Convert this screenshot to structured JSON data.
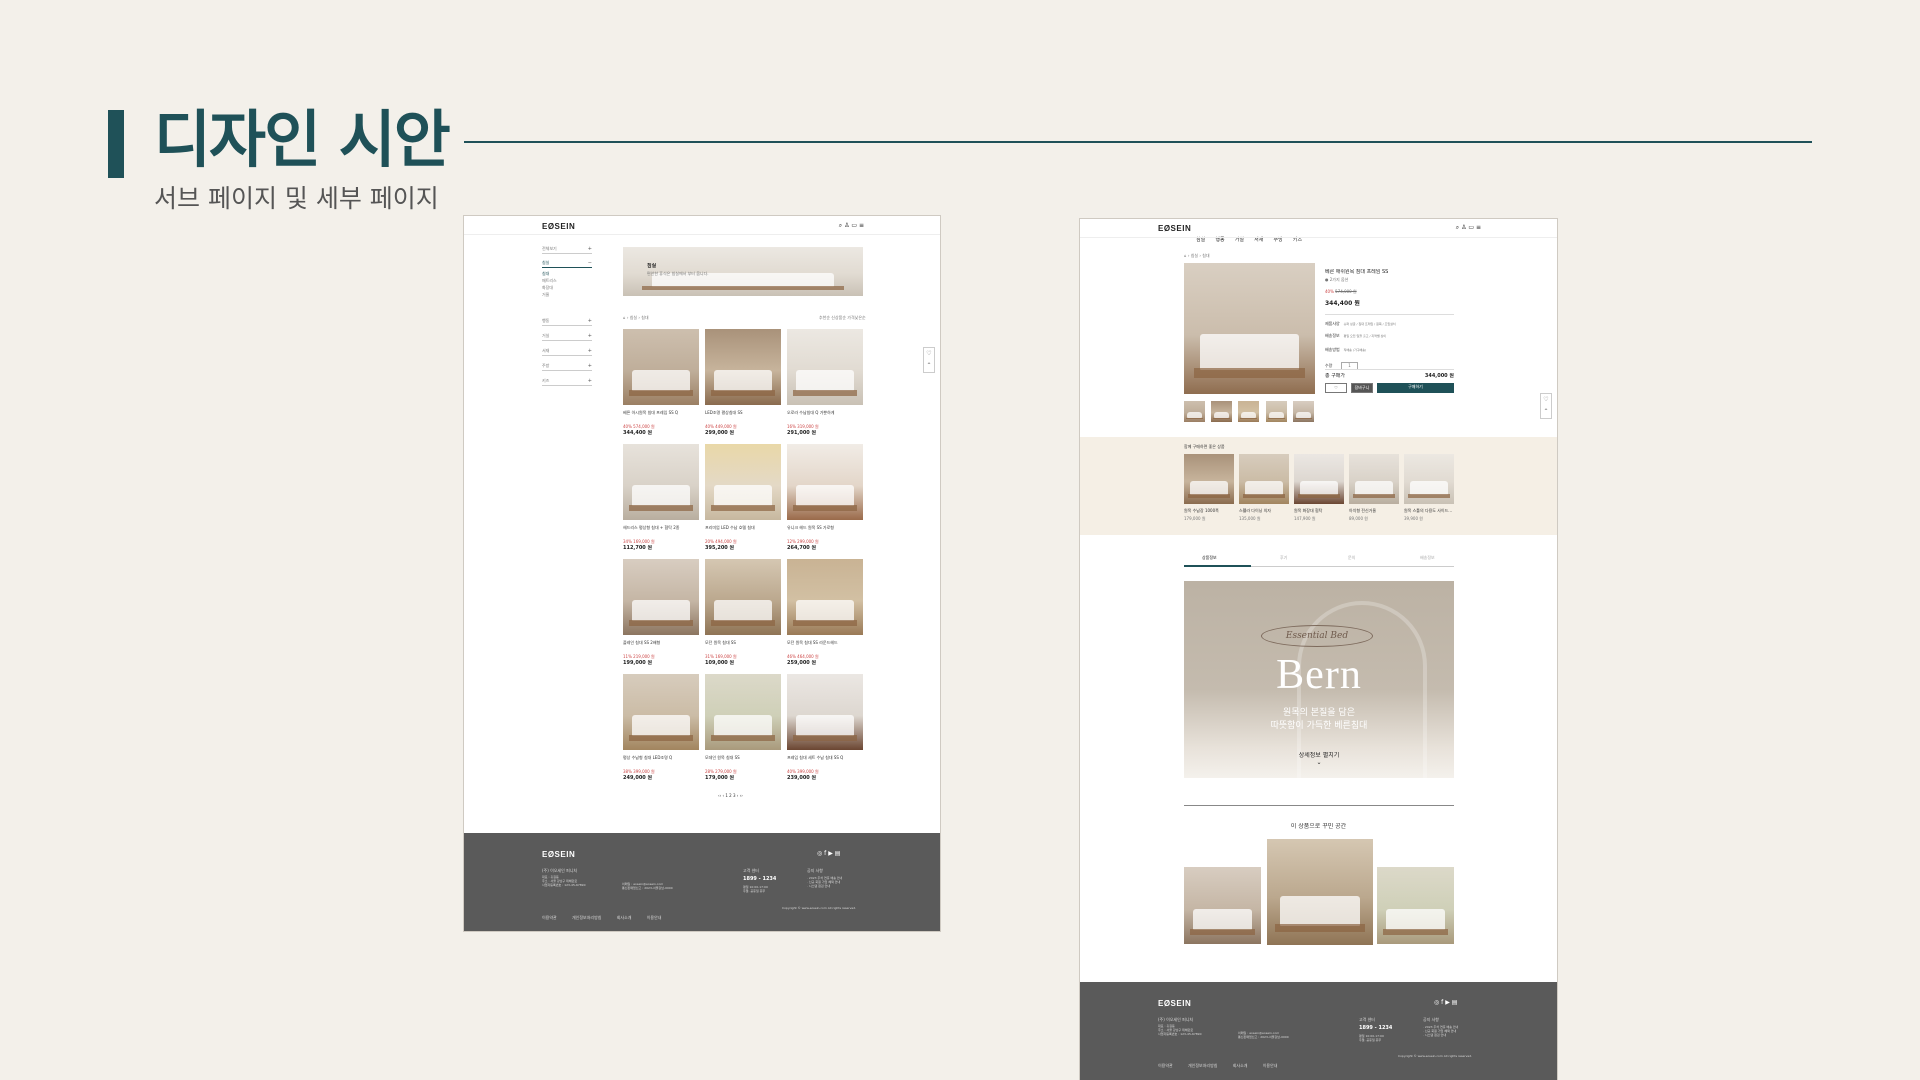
{
  "slide": {
    "title": "디자인 시안",
    "subtitle": "서브 페이지 및 세부 페이지"
  },
  "brand": {
    "logo": "EØSEIN",
    "accent": "#1f5158",
    "footer_bg": "#5a5a5a",
    "sale": "#c44444"
  },
  "category_page": {
    "header_icons": [
      "search-icon",
      "user-icon",
      "cart-icon",
      "menu-icon"
    ],
    "sidebar": [
      {
        "label": "전체보기",
        "open": false
      },
      {
        "label": "침실",
        "open": true,
        "children": [
          "침대",
          "매트리스",
          "화장대",
          "거울"
        ]
      },
      {
        "label": "행동",
        "open": false
      },
      {
        "label": "거실",
        "open": false
      },
      {
        "label": "서재",
        "open": false
      },
      {
        "label": "주방",
        "open": false
      },
      {
        "label": "키즈",
        "open": false
      }
    ],
    "banner": {
      "title": "침실",
      "text": "편안한 휴식은 침실에서 부터 옵니다."
    },
    "breadcrumb": "› 침실 › 침대",
    "sort": "추천순  신상품순  가격낮은순",
    "products": [
      {
        "name": "베른 아시원목 침대 프레임 SS Q",
        "old": "40% 574,000 원",
        "price": "344,400 원"
      },
      {
        "name": "LED조명 평상침대 SS",
        "old": "40% 449,000 원",
        "price": "299,000 원"
      },
      {
        "name": "오로라 수납침대 Q 가뿐하게",
        "old": "16% 319,000 원",
        "price": "291,000 원"
      },
      {
        "name": "헤드리스 평상형 침대 + 협탁 2종",
        "old": "34% 169,000 원",
        "price": "112,700 원"
      },
      {
        "name": "프리미엄 LED 수납 호텔 침대",
        "old": "20% 494,000 원",
        "price": "395,200 원"
      },
      {
        "name": "유니크 헤드 원목 SS 가로형",
        "old": "12% 299,000 원",
        "price": "264,700 원"
      },
      {
        "name": "플레인 침대 SS 2배형",
        "old": "11% 219,000 원",
        "price": "199,000 원"
      },
      {
        "name": "모던 원목 침대 SS",
        "old": "31% 169,000 원",
        "price": "109,000 원"
      },
      {
        "name": "모던 원목 침대 SS 라운드헤드",
        "old": "46% 464,000 원",
        "price": "259,000 원"
      },
      {
        "name": "평상 수납형 침대 LED조명 Q",
        "old": "38% 399,000 원",
        "price": "249,000 원"
      },
      {
        "name": "모데인 원목 침대 SS",
        "old": "28% 279,000 원",
        "price": "179,000 원"
      },
      {
        "name": "프레임 침대 세트 수납 침대 SS Q",
        "old": "40% 399,000 원",
        "price": "239,000 원"
      }
    ],
    "pagination": "‹‹ ‹ 1 2 3 › ››"
  },
  "detail_page": {
    "nav": [
      "침실",
      "행동",
      "거실",
      "서재",
      "주방",
      "키즈"
    ],
    "header_icons": [
      "search-icon",
      "user-icon",
      "cart-icon",
      "menu-icon"
    ],
    "breadcrumb": "› 침실 › 침대",
    "product": {
      "title": "베른 애쉬원목 침대 프레임 SS",
      "subtitle": "● 2가지 옵션",
      "discount": "40%",
      "old_price": "574,000 원",
      "price": "344,400 원",
      "specs": [
        {
          "label": "제품사양",
          "value": "슈퍼 싱글 / 침대 프레임 / 원목 / 조립설치"
        },
        {
          "label": "배송정보",
          "value": "평일 오전 일괄 출고 / 지역별 상이"
        },
        {
          "label": "배송방법",
          "value": "직배송 (가구배송)"
        },
        {
          "label": "수량",
          "value": "1"
        }
      ],
      "total_label": "총 구매가",
      "total": "344,000 원",
      "wish": "♡",
      "cart": "장바구니",
      "buy": "구매하기"
    },
    "reco": {
      "title": "함께 구매하면 좋은 상품",
      "items": [
        {
          "name": "원목 수납장 1000폭",
          "price": "179,000 원"
        },
        {
          "name": "스웰라 다이닝 의자",
          "price": "135,000 원"
        },
        {
          "name": "원목 화장대 협탁",
          "price": "147,900 원"
        },
        {
          "name": "아치형 전신거울",
          "price": "89,000 원"
        },
        {
          "name": "원목 스툴의 다용도 사이드...",
          "price": "39,900 원"
        }
      ]
    },
    "tabs": [
      "상품정보",
      "후기",
      "문의",
      "배송정보"
    ],
    "feature": {
      "badge": "Essential Bed",
      "title": "Bern",
      "line1": "원목의 본질을 담은",
      "line2": "따뜻함이 가득한 베른침대",
      "more": "상세정보 펼치기",
      "more_icon": "⌄"
    },
    "space_title": "이 상품으로 꾸민 공간"
  },
  "footer": {
    "company": "(주) 이오세인 퍼니처",
    "address": "대표 : 홍길동\n주소 : 서울 강남구 테헤란로\n사업자등록번호 : 123-45-67890",
    "contact": "이메일 : eosein@eosein.com\n통신판매업신고 : 2023-서울강남-0000",
    "cs_label": "고객 센터",
    "cs_phone": "1899 - 1234",
    "cs_hours": "평일 10:00-17:00\n주말, 공휴일 휴무",
    "notice_label": "공지 사항",
    "notice": "· 2023 추석 연휴 배송 안내\n· 신규 회원 가입 혜택 안내\n· 시스템 점검 안내",
    "links": [
      "이용약관",
      "개인정보처리방침",
      "회사소개",
      "이용안내"
    ],
    "copyright": "Copyright © www.eosein.com All rights reserved.",
    "social": [
      "instagram-icon",
      "facebook-icon",
      "youtube-icon",
      "blog-icon"
    ]
  }
}
